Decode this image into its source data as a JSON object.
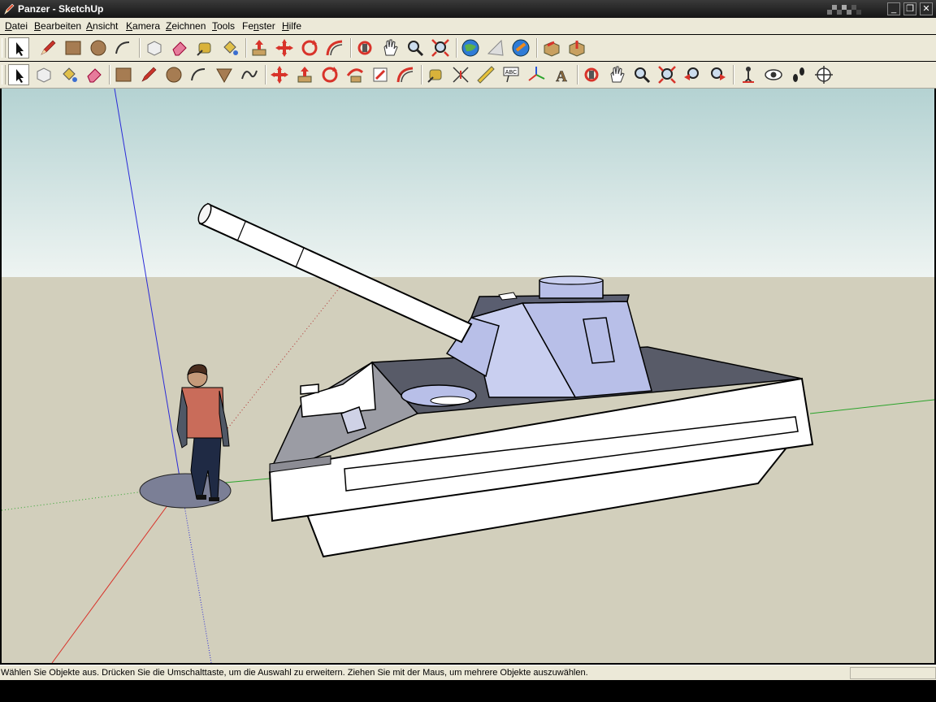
{
  "window": {
    "title": "Panzer - SketchUp",
    "app_icon": "sketchup-pencil-icon",
    "controls": {
      "minimize": "_",
      "maximize": "❐",
      "close": "✕"
    }
  },
  "menu": {
    "items": [
      {
        "pre": "",
        "key": "D",
        "post": "atei"
      },
      {
        "pre": "",
        "key": "B",
        "post": "earbeiten"
      },
      {
        "pre": "",
        "key": "A",
        "post": "nsicht"
      },
      {
        "pre": "",
        "key": "K",
        "post": "amera"
      },
      {
        "pre": "",
        "key": "Z",
        "post": "eichnen"
      },
      {
        "pre": "",
        "key": "T",
        "post": "ools"
      },
      {
        "pre": "Fe",
        "key": "n",
        "post": "ster"
      },
      {
        "pre": "",
        "key": "H",
        "post": "ilfe"
      }
    ]
  },
  "toolbar_top": {
    "tools": [
      "select-icon",
      "line-icon",
      "rectangle-icon",
      "circle-icon",
      "arc-icon",
      "make-component-icon",
      "eraser-icon",
      "tape-measure-icon",
      "paint-bucket-icon",
      "push-pull-icon",
      "move-icon",
      "rotate-icon",
      "follow-me-icon",
      "orbit-icon",
      "pan-icon",
      "zoom-icon",
      "zoom-extents-icon",
      "get-models-icon",
      "share-model-icon",
      "google-earth-icon",
      "component-box-icon",
      "get-3d-models-icon"
    ]
  },
  "toolbar_bottom": {
    "tools": [
      "select-icon",
      "make-component-icon",
      "paint-bucket-icon",
      "eraser-icon",
      "rectangle-icon",
      "line-icon",
      "circle-icon",
      "arc-icon",
      "polygon-icon",
      "freehand-icon",
      "move-icon",
      "push-pull-icon",
      "rotate-icon",
      "follow-me-icon",
      "scale-icon",
      "offset-icon",
      "tape-measure-icon",
      "dimension-icon",
      "protractor-icon",
      "text-icon",
      "axes-icon",
      "3d-text-icon",
      "orbit-icon",
      "pan-icon",
      "zoom-icon",
      "zoom-window-icon",
      "previous-view-icon",
      "next-view-icon",
      "position-camera-icon",
      "look-around-icon",
      "walk-icon",
      "section-plane-icon"
    ]
  },
  "viewport": {
    "sky_color": "#c5dcdc",
    "ground_color": "#d2cfbc",
    "model_face_color": "#ffffff",
    "model_back_color": "#b8bfe8",
    "model_shadow_color": "#7b7f96"
  },
  "statusbar": {
    "message": "Wählen Sie Objekte aus. Drücken Sie die Umschalttaste, um die Auswahl zu erweitern. Ziehen Sie mit der Maus, um mehrere Objekte auszuwählen.",
    "measurements_value": ""
  }
}
